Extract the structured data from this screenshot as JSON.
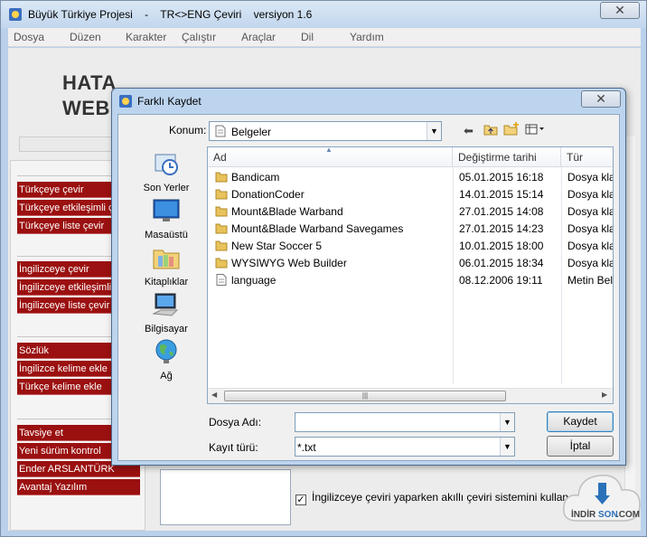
{
  "app": {
    "title": "Büyük Türkiye Projesi    -    TR<>ENG Çeviri    versiyon 1.6",
    "close_symbol": "✕"
  },
  "menu": [
    "Dosya",
    "Düzen",
    "Karakter",
    "Çalıştır",
    "Araçlar",
    "Dil",
    "Yardım"
  ],
  "page": {
    "heading_line1": "HATA",
    "heading_line2": "WEB"
  },
  "sidebar": {
    "group1": [
      "Türkçeye çevir",
      "Türkçeye etkileşimli çe",
      "Türkçeye liste çevir"
    ],
    "group2": [
      "İngilizceye çevir",
      "İngilizceye etkileşimli ç",
      "İngilizceye liste çevir"
    ],
    "group3": [
      "Sözlük",
      "İngilizce kelime ekle",
      "Türkçe kelime ekle"
    ],
    "group4": [
      "Tavsiye et",
      "Yeni sürüm kontrol",
      "Ender ARSLANTÜRK",
      "Avantaj Yazılım"
    ]
  },
  "checkbox": {
    "label": "İngilizceye çeviri yaparken akıllı çeviri sistemini kullan ...",
    "checked": true,
    "mark": "✓"
  },
  "dialog": {
    "title": "Farklı Kaydet",
    "close_symbol": "✕",
    "location_label": "Konum:",
    "location_value": "Belgeler",
    "places": [
      "Son Yerler",
      "Masaüstü",
      "Kitaplıklar",
      "Bilgisayar",
      "Ağ"
    ],
    "columns": [
      "Ad",
      "Değiştirme tarihi",
      "Tür"
    ],
    "files": [
      {
        "name": "Bandicam",
        "date": "05.01.2015 16:18",
        "type": "Dosya klas",
        "kind": "folder"
      },
      {
        "name": "DonationCoder",
        "date": "14.01.2015 15:14",
        "type": "Dosya klas",
        "kind": "folder"
      },
      {
        "name": "Mount&Blade Warband",
        "date": "27.01.2015 14:08",
        "type": "Dosya klas",
        "kind": "folder"
      },
      {
        "name": "Mount&Blade Warband Savegames",
        "date": "27.01.2015 14:23",
        "type": "Dosya klas",
        "kind": "folder"
      },
      {
        "name": "New Star Soccer 5",
        "date": "10.01.2015 18:00",
        "type": "Dosya klas",
        "kind": "folder"
      },
      {
        "name": "WYSIWYG Web Builder",
        "date": "06.01.2015 18:34",
        "type": "Dosya klas",
        "kind": "folder"
      },
      {
        "name": "language",
        "date": "08.12.2006 19:11",
        "type": "Metin Belg",
        "kind": "file"
      }
    ],
    "filename_label": "Dosya Adı:",
    "filename_value": "",
    "filetype_label": "Kayıt türü:",
    "filetype_value": "*.txt",
    "save_button": "Kaydet",
    "cancel_button": "İptal"
  },
  "watermark": {
    "text_a": "İNDİR",
    "text_b": "SON",
    "text_c": ".COM"
  },
  "colors": {
    "sidebar_red": "#9b1010",
    "title_bar": "#c2d6ed",
    "folder": "#e8c25a"
  }
}
